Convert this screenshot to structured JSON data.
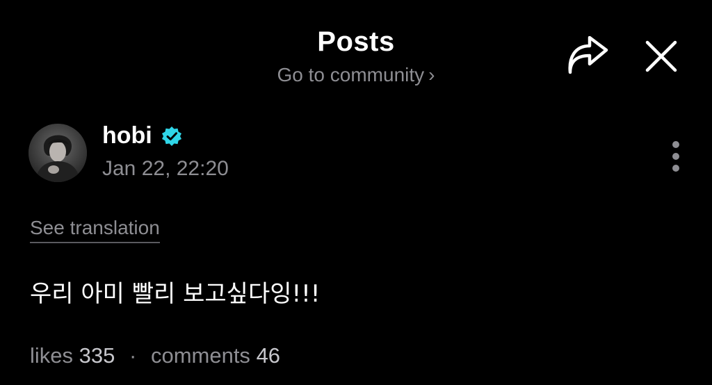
{
  "header": {
    "title": "Posts",
    "community_link": "Go to community",
    "community_chevron": "›"
  },
  "icons": {
    "share": "share-icon",
    "close": "close-icon",
    "more": "more-vertical-icon",
    "verified": "verified-badge-icon"
  },
  "post": {
    "author": "hobi",
    "timestamp": "Jan 22, 22:20",
    "see_translation": "See translation",
    "body": "우리 아미 빨리 보고싶다잉!!!",
    "likes_label": "likes",
    "likes_count": "335",
    "separator": "·",
    "comments_label": "comments",
    "comments_count": "46"
  },
  "colors": {
    "background": "#000000",
    "primary_text": "#ffffff",
    "secondary_text": "#8e8e93",
    "verified_badge": "#2fd6e8"
  }
}
